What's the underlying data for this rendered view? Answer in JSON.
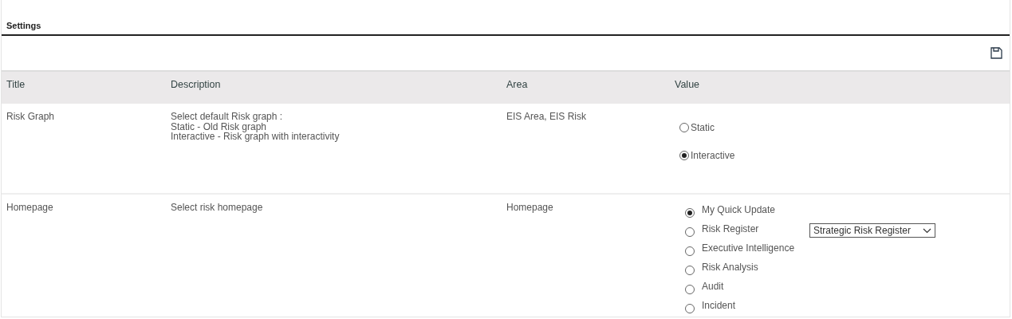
{
  "section_title": "Settings",
  "table": {
    "columns": [
      "Title",
      "Description",
      "Area",
      "Value"
    ],
    "rows": [
      {
        "title": "Risk Graph",
        "description": "Select default Risk graph :\nStatic - Old Risk graph\nInteractive - Risk graph with interactivity",
        "area": "EIS Area, EIS Risk",
        "value": {
          "kind": "compact",
          "options": [
            {
              "label": "Static",
              "selected": false
            },
            {
              "label": "Interactive",
              "selected": true
            }
          ]
        }
      },
      {
        "title": "Homepage",
        "description": "Select risk homepage",
        "area": "Homepage",
        "value": {
          "kind": "spaced",
          "options": [
            {
              "label": "My Quick Update",
              "selected": true
            },
            {
              "label": "Risk Register",
              "selected": false,
              "dropdown": {
                "value": "Strategic Risk Register"
              }
            },
            {
              "label": "Executive Intelligence",
              "selected": false
            },
            {
              "label": "Risk Analysis",
              "selected": false
            },
            {
              "label": "Audit",
              "selected": false
            },
            {
              "label": "Incident",
              "selected": false
            }
          ]
        }
      }
    ]
  }
}
